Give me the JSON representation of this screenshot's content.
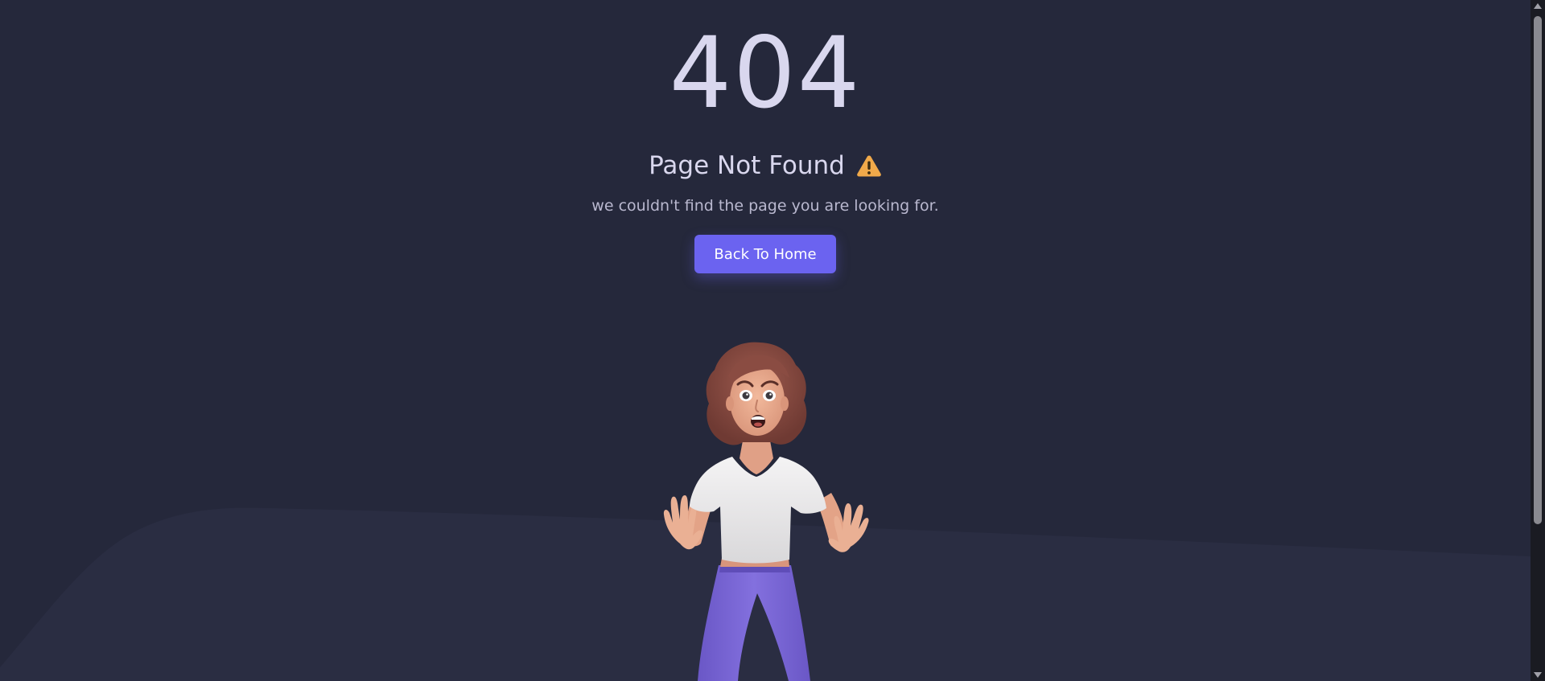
{
  "error": {
    "code": "404",
    "title": "Page Not Found",
    "title_icon": "warning-icon",
    "message": "we couldn't find the page you are looking for.",
    "button_label": "Back To Home"
  },
  "illustration": {
    "subject": "surprised-woman-character"
  },
  "colors": {
    "background": "#25283b",
    "wave": "#2a2d42",
    "accent": "#6b63f0",
    "text_primary": "#d9d7ee",
    "text_secondary": "#b9b8cf",
    "warning": "#f0a94a",
    "pants": "#7b67d6",
    "shirt": "#ecebec",
    "hair": "#8d4f45",
    "skin": "#e8a98c"
  }
}
